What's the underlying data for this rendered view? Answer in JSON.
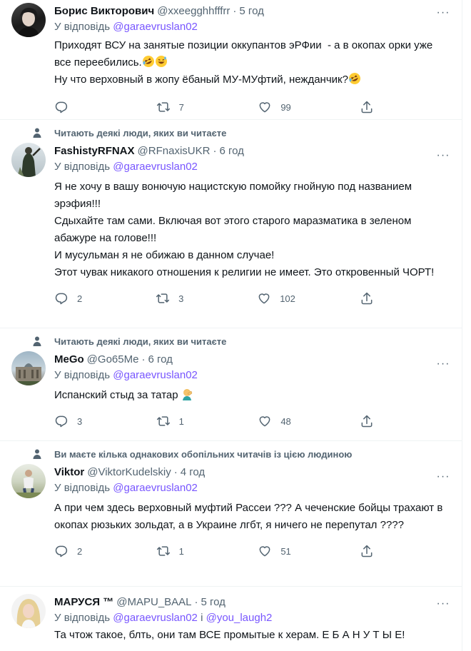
{
  "tweets": [
    {
      "social": "",
      "name": "Борис Викторович",
      "handle": "@xxeegghhfffrr",
      "dot": "·",
      "time": "5 год",
      "reply_prefix": "У відповідь",
      "reply_mentions": "@garaevruslan02",
      "lines": [
        "Приходят ВСУ на занятые позиции оккупантов эРФии  - а в окопах орки уже все переебились.",
        "Ну что верховный в жопу ёбаный МУ-МУфтий, нежданчик?"
      ],
      "replies": "",
      "retweets": "7",
      "likes": "99"
    },
    {
      "social": "Читають деякі люди, яких ви читаєте",
      "name": "FashistyRFNAX",
      "handle": "@RFnaxisUKR",
      "dot": "·",
      "time": "6 год",
      "reply_prefix": "У відповідь",
      "reply_mentions": "@garaevruslan02",
      "lines": [
        "Я не хочу в вашу вонючую нацистскую помойку гнойную под названием эрэфия!!!",
        "Сдыхайте там сами. Включая вот этого старого маразматика в зеленом абажуре на голове!!!",
        "И мусульман я не обижаю в данном случае!",
        "Этот чувак никакого отношения к религии не имеет. Это откровенный ЧОРТ!"
      ],
      "replies": "2",
      "retweets": "3",
      "likes": "102"
    },
    {
      "social": "Читають деякі люди, яких ви читаєте",
      "name": "MeGo",
      "handle": "@Go65Me",
      "dot": "·",
      "time": "6 год",
      "reply_prefix": "У відповідь",
      "reply_mentions": "@garaevruslan02",
      "lines": [
        "Испанский стыд за татар"
      ],
      "replies": "3",
      "retweets": "1",
      "likes": "48"
    },
    {
      "social": "Ви маєте кілька однакових обопільних читачів із цією людиною",
      "name": "Viktor",
      "handle": "@ViktorKudelskiy",
      "dot": "·",
      "time": "4 год",
      "reply_prefix": "У відповідь",
      "reply_mentions": "@garaevruslan02",
      "lines": [
        "А при чем здесь верховный муфтий Рассеи ??? А чеченские бойцы трахают в окопах рюзьких зольдат, а в Украине лгбт, я ничего не перепутал ????"
      ],
      "replies": "2",
      "retweets": "1",
      "likes": "51"
    },
    {
      "social": "",
      "name": "МАРУСЯ ™",
      "handle": "@MAPU_BAAL",
      "dot": "·",
      "time": "5 год",
      "reply_prefix": "У відповідь",
      "reply_mentions": "@garaevruslan02",
      "reply_and": "і",
      "reply_mentions_2": "@you_laugh2",
      "lines": [
        "Та чтож такое, блть, они там ВСЕ промытые к херам. Е Б А Н У Т Ы Е!"
      ]
    }
  ],
  "colors": {
    "text": "#0f1419",
    "secondary": "#536471",
    "mention": "#7856ff",
    "border": "#eff3f4"
  },
  "icons": {
    "more": "more-dots-icon",
    "reply": "reply-bubble-icon",
    "retweet": "retweet-arrows-icon",
    "like": "heart-icon",
    "share": "share-upload-icon",
    "social_context": "person-icon",
    "emoji_1": "rofl-emoji-icon",
    "emoji_2": "grinning-sweat-emoji-icon",
    "emoji_3": "facepalm-emoji-icon"
  }
}
